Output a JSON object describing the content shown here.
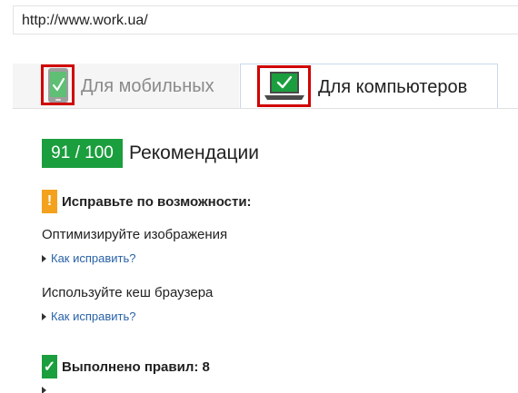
{
  "address_bar": {
    "url": "http://www.work.ua/"
  },
  "tabs": [
    {
      "label": "Для мобильных",
      "icon": "mobile-phone-check-icon",
      "active": false
    },
    {
      "label": "Для компьютеров",
      "icon": "laptop-check-icon",
      "active": true
    }
  ],
  "score": {
    "value": "91 / 100",
    "label": "Рекомендации",
    "color": "#1b9e3e"
  },
  "warnings": {
    "icon_glyph": "!",
    "title": "Исправьте по возможности:",
    "color": "#f4a11e",
    "items": [
      {
        "text": "Оптимизируйте изображения",
        "link": "Как исправить?"
      },
      {
        "text": "Используйте кеш браузера",
        "link": "Как исправить?"
      }
    ]
  },
  "passed": {
    "icon_glyph": "✓",
    "title": "Выполнено правил: 8"
  },
  "annotation": {
    "highlight_color": "#d10000"
  }
}
